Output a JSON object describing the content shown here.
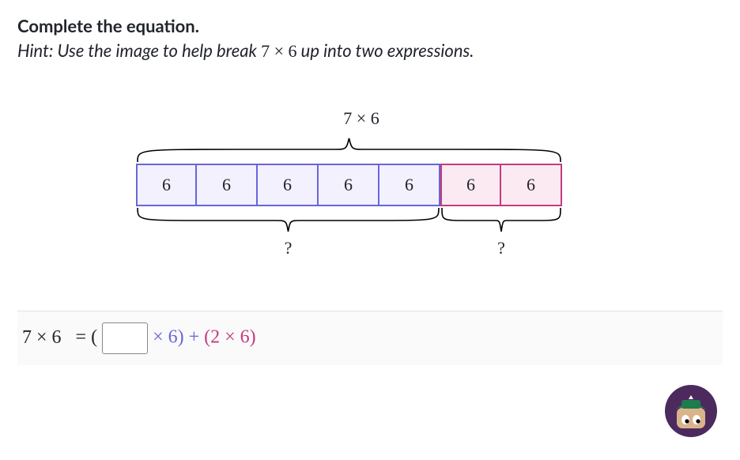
{
  "prompt": {
    "title": "Complete the equation.",
    "hint_pre": "Hint: Use the image to help break ",
    "hint_expr": "7 × 6",
    "hint_post": " up into two expressions."
  },
  "diagram": {
    "top_label": "7 × 6",
    "cells_purple": [
      "6",
      "6",
      "6",
      "6",
      "6"
    ],
    "cells_pink": [
      "6",
      "6"
    ],
    "q_left": "?",
    "q_right": "?"
  },
  "equation": {
    "lhs": "7 × 6",
    "eq": "= (",
    "input_value": "",
    "input_placeholder": "",
    "after_input": " × 6) + ",
    "pink_part": "(2 × 6)"
  },
  "colors": {
    "purple": "#6865db",
    "pink": "#c33b7f"
  }
}
